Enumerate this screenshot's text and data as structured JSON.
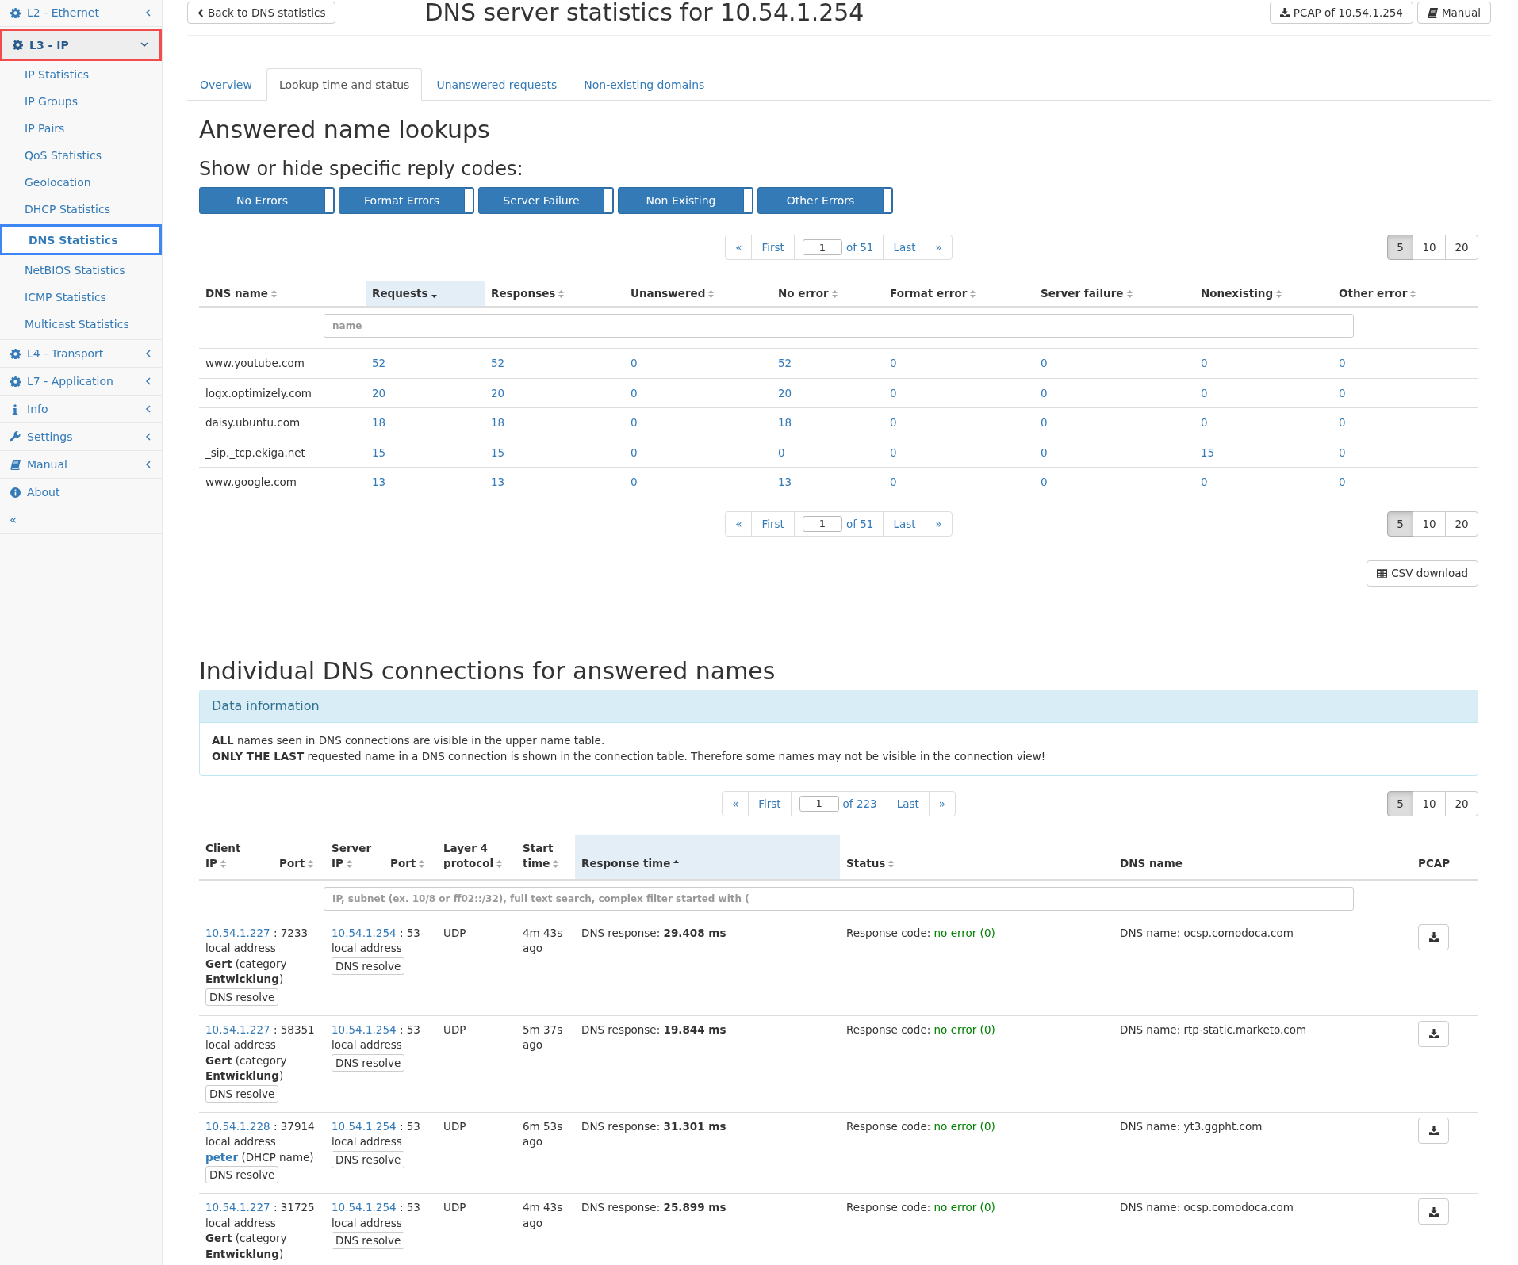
{
  "sidebar": {
    "groups": [
      {
        "kind": "group",
        "label": "L2 - Ethernet",
        "expanded": false,
        "selected": false
      },
      {
        "kind": "group",
        "label": "L3 - IP",
        "expanded": true,
        "selected": true,
        "children": [
          {
            "label": "IP Statistics",
            "selected": false
          },
          {
            "label": "IP Groups",
            "selected": false
          },
          {
            "label": "IP Pairs",
            "selected": false
          },
          {
            "label": "QoS Statistics",
            "selected": false
          },
          {
            "label": "Geolocation",
            "selected": false
          },
          {
            "label": "DHCP Statistics",
            "selected": false
          },
          {
            "label": "DNS Statistics",
            "selected": true
          },
          {
            "label": "NetBIOS Statistics",
            "selected": false
          },
          {
            "label": "ICMP Statistics",
            "selected": false
          },
          {
            "label": "Multicast Statistics",
            "selected": false
          }
        ]
      },
      {
        "kind": "group",
        "label": "L4 - Transport",
        "expanded": false,
        "selected": false
      },
      {
        "kind": "group",
        "label": "L7 - Application",
        "expanded": false,
        "selected": false
      },
      {
        "kind": "group",
        "label": "Info",
        "expanded": false,
        "selected": false
      },
      {
        "kind": "group",
        "label": "Settings",
        "expanded": false,
        "selected": false
      },
      {
        "kind": "group",
        "label": "Manual",
        "expanded": false,
        "selected": false
      },
      {
        "kind": "link",
        "label": "About",
        "selected": false
      }
    ],
    "collapse": "«"
  },
  "header": {
    "back": "Back to DNS statistics",
    "title": "DNS server statistics for 10.54.1.254",
    "buttons": [
      {
        "label": "PCAP of 10.54.1.254"
      },
      {
        "label": "Manual"
      }
    ]
  },
  "tabs": [
    {
      "label": "Overview",
      "selected": false
    },
    {
      "label": "Lookup time and status",
      "selected": true
    },
    {
      "label": "Unanswered requests",
      "selected": false
    },
    {
      "label": "Non-existing domains",
      "selected": false
    }
  ],
  "names_section": {
    "title": "Answered name lookups",
    "subtitle": "Show or hide specific reply codes:",
    "reply_codes": [
      {
        "label": "No Errors",
        "on": true
      },
      {
        "label": "Format Errors",
        "on": true
      },
      {
        "label": "Server Failure",
        "on": true
      },
      {
        "label": "Non Existing",
        "on": true
      },
      {
        "label": "Other Errors",
        "on": true
      }
    ],
    "pager_top": {
      "prev": "«",
      "first": "First",
      "page": "1",
      "of": "of 51",
      "last": "Last",
      "next": "»",
      "sizes": [
        {
          "label": "5",
          "selected": true
        },
        {
          "label": "10",
          "selected": false
        },
        {
          "label": "20",
          "selected": false
        }
      ]
    },
    "table": {
      "columns": [
        {
          "label": "DNS name",
          "sorted_ascending": false,
          "sorted_descending": false
        },
        {
          "label": "Requests",
          "sorted_ascending": false,
          "sorted_descending": true
        },
        {
          "label": "Responses",
          "sorted_ascending": false,
          "sorted_descending": false
        },
        {
          "label": "Unanswered",
          "sorted_ascending": false,
          "sorted_descending": false
        },
        {
          "label": "No error",
          "sorted_ascending": false,
          "sorted_descending": false
        },
        {
          "label": "Format error",
          "sorted_ascending": false,
          "sorted_descending": false
        },
        {
          "label": "Server failure",
          "sorted_ascending": false,
          "sorted_descending": false
        },
        {
          "label": "Nonexisting",
          "sorted_ascending": false,
          "sorted_descending": false
        },
        {
          "label": "Other error",
          "sorted_ascending": false,
          "sorted_descending": false
        }
      ],
      "filter_placeholder": "name",
      "rows": [
        [
          "www.youtube.com",
          "52",
          "52",
          "0",
          "52",
          "0",
          "0",
          "0",
          "0"
        ],
        [
          "logx.optimizely.com",
          "20",
          "20",
          "0",
          "20",
          "0",
          "0",
          "0",
          "0"
        ],
        [
          "daisy.ubuntu.com",
          "18",
          "18",
          "0",
          "18",
          "0",
          "0",
          "0",
          "0"
        ],
        [
          "_sip._tcp.ekiga.net",
          "15",
          "15",
          "0",
          "0",
          "0",
          "0",
          "15",
          "0"
        ],
        [
          "www.google.com",
          "13",
          "13",
          "0",
          "13",
          "0",
          "0",
          "0",
          "0"
        ]
      ]
    },
    "pager_bottom": {
      "prev": "«",
      "first": "First",
      "page": "1",
      "of": "of 51",
      "last": "Last",
      "next": "»",
      "sizes": [
        {
          "label": "5",
          "selected": true
        },
        {
          "label": "10",
          "selected": false
        },
        {
          "label": "20",
          "selected": false
        }
      ]
    },
    "csv": "CSV download"
  },
  "connections_section": {
    "title": "Individual DNS connections for answered names",
    "info": {
      "title": "Data information",
      "lines": [
        "**ALL** names seen in DNS connections are visible in the upper name table.",
        "**ONLY THE LAST** requested name in a DNS connection is shown in the connection table. Therefore some names may not be visible in the connection view!"
      ]
    },
    "pager": {
      "prev": "«",
      "first": "First",
      "page": "1",
      "of": "of 223",
      "last": "Last",
      "next": "»",
      "sizes": [
        {
          "label": "5",
          "selected": true
        },
        {
          "label": "10",
          "selected": false
        },
        {
          "label": "20",
          "selected": false
        }
      ]
    },
    "table": {
      "columns": [
        {
          "label": "Client IP",
          "sortable": true,
          "sorted_ascending": false,
          "sorted_descending": false
        },
        {
          "label": "Port",
          "sortable": true,
          "sorted_ascending": false,
          "sorted_descending": false
        },
        {
          "label": "Server IP",
          "sortable": true,
          "sorted_ascending": false,
          "sorted_descending": false
        },
        {
          "label": "Port",
          "sortable": true,
          "sorted_ascending": false,
          "sorted_descending": false
        },
        {
          "label": "Layer 4 protocol",
          "sortable": true,
          "sorted_ascending": false,
          "sorted_descending": false
        },
        {
          "label": "Start time",
          "sortable": true,
          "sorted_ascending": false,
          "sorted_descending": false
        },
        {
          "label": "Response time",
          "sortable": true,
          "sorted_ascending": true,
          "sorted_descending": false
        },
        {
          "label": "Status",
          "sortable": true,
          "sorted_ascending": false,
          "sorted_descending": false
        },
        {
          "label": "DNS name",
          "sortable": false
        },
        {
          "label": "PCAP",
          "sortable": false
        }
      ],
      "filter_placeholder": "IP, subnet (ex. 10/8 or ff02::/32), full text search, complex filter started with (",
      "rows": [
        {
          "client": {
            "ip": "10.54.1.227",
            "port": ": 7233",
            "note": "local address",
            "host": {
              "kind": "text",
              "text": "**Gert** (category **Entwicklung**)"
            },
            "resolve": "DNS resolve"
          },
          "server": {
            "ip": "10.54.1.254",
            "port": ": 53",
            "note": "local address",
            "resolve": "DNS resolve"
          },
          "protocol": "UDP",
          "start": "4m 43s ago",
          "response": "DNS response: **29.408 ms**",
          "status_label": "Response code:",
          "status_value": "no error (0)",
          "status_ok": true,
          "dns_name": "DNS name: ocsp.comodoca.com"
        },
        {
          "client": {
            "ip": "10.54.1.227",
            "port": ": 58351",
            "note": "local address",
            "host": {
              "kind": "text",
              "text": "**Gert** (category **Entwicklung**)"
            },
            "resolve": "DNS resolve"
          },
          "server": {
            "ip": "10.54.1.254",
            "port": ": 53",
            "note": "local address",
            "resolve": "DNS resolve"
          },
          "protocol": "UDP",
          "start": "5m 37s ago",
          "response": "DNS response: **19.844 ms**",
          "status_label": "Response code:",
          "status_value": "no error (0)",
          "status_ok": true,
          "dns_name": "DNS name: rtp-static.marketo.com"
        },
        {
          "client": {
            "ip": "10.54.1.228",
            "port": ": 37914",
            "note": "local address",
            "host": {
              "kind": "link",
              "link": "peter",
              "note": "(DHCP name)"
            },
            "resolve": "DNS resolve"
          },
          "server": {
            "ip": "10.54.1.254",
            "port": ": 53",
            "note": "local address",
            "resolve": "DNS resolve"
          },
          "protocol": "UDP",
          "start": "6m 53s ago",
          "response": "DNS response: **31.301 ms**",
          "status_label": "Response code:",
          "status_value": "no error (0)",
          "status_ok": true,
          "dns_name": "DNS name: yt3.ggpht.com"
        },
        {
          "client": {
            "ip": "10.54.1.227",
            "port": ": 31725",
            "note": "local address",
            "host": {
              "kind": "text",
              "text": "**Gert** (category **Entwicklung**)"
            }
          },
          "server": {
            "ip": "10.54.1.254",
            "port": ": 53",
            "note": "local address",
            "resolve": "DNS resolve"
          },
          "protocol": "UDP",
          "start": "4m 43s ago",
          "response": "DNS response: **25.899 ms**",
          "status_label": "Response code:",
          "status_value": "no error (0)",
          "status_ok": true,
          "dns_name": "DNS name: ocsp.comodoca.com"
        }
      ]
    }
  }
}
